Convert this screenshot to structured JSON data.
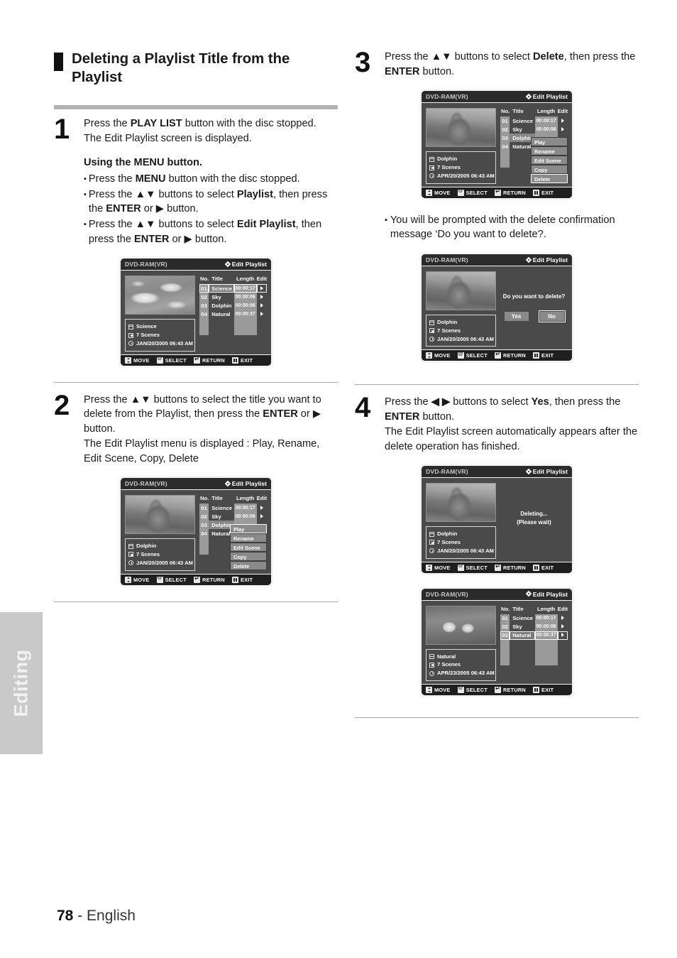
{
  "side_tab": {
    "label": "Editing"
  },
  "heading": {
    "title": "Deleting a Playlist Title from the Playlist"
  },
  "footer": {
    "page": "78",
    "dash": "-",
    "language": "English"
  },
  "steps": {
    "s1": {
      "num": "1",
      "line1_a": "Press the ",
      "line1_b": "PLAY LIST",
      "line1_c": " button with the disc stopped.",
      "line2": "The Edit Playlist screen is displayed.",
      "subhead": "Using the MENU button.",
      "b1_a": "Press the ",
      "b1_b": "MENU",
      "b1_c": " button with the disc stopped.",
      "b2_a": "Press the ",
      "b2_b": "▲▼",
      "b2_c": " buttons to select ",
      "b2_d": "Playlist",
      "b2_e": ", then press the ",
      "b2_f": "ENTER",
      "b2_g": " or ▶ button.",
      "b3_a": "Press the ",
      "b3_b": "▲▼",
      "b3_c": " buttons to select ",
      "b3_d": "Edit Playlist",
      "b3_e": ", then press the ",
      "b3_f": "ENTER",
      "b3_g": " or ▶ button."
    },
    "s2": {
      "num": "2",
      "t_a": "Press the ",
      "t_b": "▲▼",
      "t_c": " buttons to select the title you want to delete from the Playlist, then press the ",
      "t_d": "ENTER",
      "t_e": " or ▶ button.",
      "t_f": "The Edit Playlist menu is displayed : Play, Rename, Edit Scene, Copy, Delete"
    },
    "s3": {
      "num": "3",
      "t_a": "Press the ",
      "t_b": "▲▼",
      "t_c": " buttons to select ",
      "t_d": "Delete",
      "t_e": ", then press the ",
      "t_f": "ENTER",
      "t_g": " button.",
      "note": "You will be prompted with the delete confirmation message ‘Do you want to delete?."
    },
    "s4": {
      "num": "4",
      "t_a": "Press the ",
      "t_b": "◀ ▶",
      "t_c": " buttons to select ",
      "t_d": "Yes",
      "t_e": ", then press the ",
      "t_f": "ENTER",
      "t_g": " button.",
      "t_h": "The Edit Playlist screen automatically appears after the delete operation has finished."
    }
  },
  "screen_common": {
    "disc_label": "DVD-RAM(VR)",
    "mode_label": "Edit Playlist",
    "col_no": "No.",
    "col_title": "Title",
    "col_length": "Length",
    "col_edit": "Edit",
    "foot": {
      "move": "MOVE",
      "select": "SELECT",
      "return": "RETURN",
      "exit": "EXIT"
    }
  },
  "screens": {
    "screen1": {
      "thumb": "birds-thumbnail",
      "info": {
        "title": "Science",
        "scenes": "7 Scenes",
        "date": "JAN/20/2005 06:43 AM"
      },
      "rows": [
        {
          "no": "01",
          "title": "Science",
          "length": "00:00:17",
          "selected": true
        },
        {
          "no": "02",
          "title": "Sky",
          "length": "00:00:06",
          "selected": false
        },
        {
          "no": "03",
          "title": "Dolphin",
          "length": "00:00:06",
          "selected": false
        },
        {
          "no": "04",
          "title": "Natural",
          "length": "00:00:37",
          "selected": false
        }
      ]
    },
    "screen2": {
      "thumb": "dolphin-thumbnail",
      "info": {
        "title": "Dolphin",
        "scenes": "7 Scenes",
        "date": "JAN/20/2005 06:43 AM"
      },
      "rows": [
        {
          "no": "01",
          "title": "Science",
          "length": "00:00:17",
          "selected": false
        },
        {
          "no": "02",
          "title": "Sky",
          "length": "00:00:06",
          "selected": false
        },
        {
          "no": "03",
          "title": "Dolphin",
          "length": "",
          "selected": false,
          "highlight": true
        },
        {
          "no": "04",
          "title": "Natural",
          "length": "",
          "selected": false
        }
      ],
      "menu": [
        {
          "label": "Play",
          "selected": true
        },
        {
          "label": "Rename",
          "selected": false
        },
        {
          "label": "Edit Scene",
          "selected": false
        },
        {
          "label": "Copy",
          "selected": false
        },
        {
          "label": "Delete",
          "selected": false
        }
      ]
    },
    "screen3": {
      "thumb": "dolphin-thumbnail",
      "info": {
        "title": "Dolphin",
        "scenes": "7 Scenes",
        "date": "APR/20/2005 06:43 AM"
      },
      "rows": [
        {
          "no": "01",
          "title": "Science",
          "length": "00:00:17",
          "selected": false
        },
        {
          "no": "02",
          "title": "Sky",
          "length": "00:00:06",
          "selected": false
        },
        {
          "no": "03",
          "title": "Dolphin",
          "length": "",
          "selected": false,
          "highlight": true
        },
        {
          "no": "04",
          "title": "Natural",
          "length": "",
          "selected": false
        }
      ],
      "menu": [
        {
          "label": "Play",
          "selected": false
        },
        {
          "label": "Rename",
          "selected": false
        },
        {
          "label": "Edit Scene",
          "selected": false
        },
        {
          "label": "Copy",
          "selected": false
        },
        {
          "label": "Delete",
          "selected": true
        }
      ]
    },
    "screen4": {
      "thumb": "dolphin-thumbnail",
      "info": {
        "title": "Dolphin",
        "scenes": "7 Scenes",
        "date": "JAN/20/2005 06:43 AM"
      },
      "dialog": {
        "message": "Do you want to delete?",
        "yes": "Yes",
        "no": "No",
        "selected": "No"
      }
    },
    "screen5": {
      "thumb": "dolphin-thumbnail",
      "info": {
        "title": "Dolphin",
        "scenes": "7 Scenes",
        "date": "JAN/20/2005 06:43 AM"
      },
      "wait_line1": "Deleting...",
      "wait_line2": "(Please wait)"
    },
    "screen6": {
      "thumb": "otters-thumbnail",
      "info": {
        "title": "Natural",
        "scenes": "7 Scenes",
        "date": "APR/23/2005 06:43 AM"
      },
      "rows": [
        {
          "no": "01",
          "title": "Science",
          "length": "00:00:17",
          "selected": false
        },
        {
          "no": "02",
          "title": "Sky",
          "length": "00:00:06",
          "selected": false
        },
        {
          "no": "03",
          "title": "Natural",
          "length": "00:00:37",
          "selected": true
        }
      ]
    }
  }
}
